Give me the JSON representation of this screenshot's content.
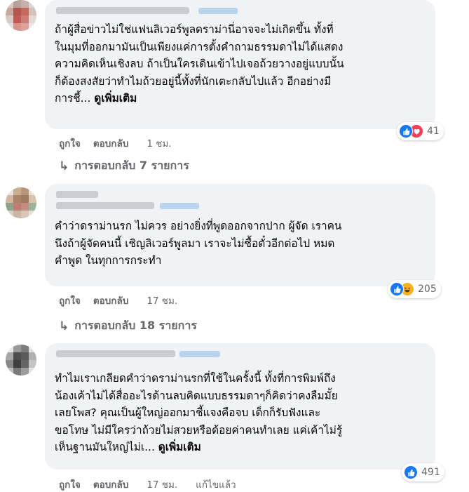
{
  "comments": [
    {
      "lines": [
        "ถ้าผู้สื่อข่าวไม่ใช่แฟนลิเวอร์พูลดราม่านี่อาจจะไม่เกิดขึ้น ทั้งที่",
        "ในมุมที่ออกมามันเป็นเพียงแค่การตั้งคำถามธรรมดาไม่ได้แสดง",
        "ความคิดเห็นเชิงลบ ถ้าเป็นใครเดินเข้าไปเจอถ้วยวางอยู่แบบนั้น",
        "ก็ต้องสงสัยว่าทำไมถ้วยอยู่นี้ทั้งที่นักเตะกลับไปแล้ว อีกอย่างมี",
        "การชี้..."
      ],
      "see_more": "ดูเพิ่มเติม",
      "reaction_count": "41",
      "reactions": [
        "like",
        "love"
      ],
      "like_label": "ถูกใจ",
      "reply_label": "ตอบกลับ",
      "time": "1 ชม.",
      "replies_label": "การตอบกลับ 7 รายการ"
    },
    {
      "lines": [
        "คำว่าดราม่านรก ไม่ควร อย่างยิ่งที่พูดออกจากปาก ผู้จัด เราคน",
        "นึงถ้าผู้จัดคนนี้ เชิญลิเวอร์พูลมา เราจะไม่ซื้อตั๋วอีกต่อไป หมด",
        "คำพูด ในทุกการกระทำ"
      ],
      "reaction_count": "205",
      "reactions": [
        "like",
        "haha"
      ],
      "like_label": "ถูกใจ",
      "reply_label": "ตอบกลับ",
      "time": "17 ชม.",
      "replies_label": "การตอบกลับ 18 รายการ"
    },
    {
      "lines": [
        "ทำไมเราเกลียดคำว่าดราม่านรกที่ใช้ในครั้งนี้ ทั้งที่การพิมพ์ถึง",
        "น้องเค้าไม่ได้สื่ออะไรด้านลบคิดแบบธรรมดาๆก็คิดว่าคงลืมมั้ย",
        "เลยโพส? คุณเป็นผู้ใหญ่ออกมาชี้แจงคือจบ เด็กก็รับฟังและ",
        "ขอโทษ ไม่มีใครว่าถ้วยไม่สวยหรือด้อยค่าคนทำเลย แค่เค้าไม่รู้",
        "เห็นฐานมันใหญ่ไม่เ..."
      ],
      "see_more": "ดูเพิ่มเติม",
      "reaction_count": "491",
      "reactions": [
        "like"
      ],
      "like_label": "ถูกใจ",
      "reply_label": "ตอบกลับ",
      "time": "17 ชม.",
      "edited": "แก้ไขแล้ว"
    }
  ],
  "colors": {
    "bubble": "#f0f2f5",
    "meta_text": "#65676b",
    "like_blue": "#1877f2",
    "love_red": "#f33e58",
    "haha_yellow": "#f7b125"
  }
}
